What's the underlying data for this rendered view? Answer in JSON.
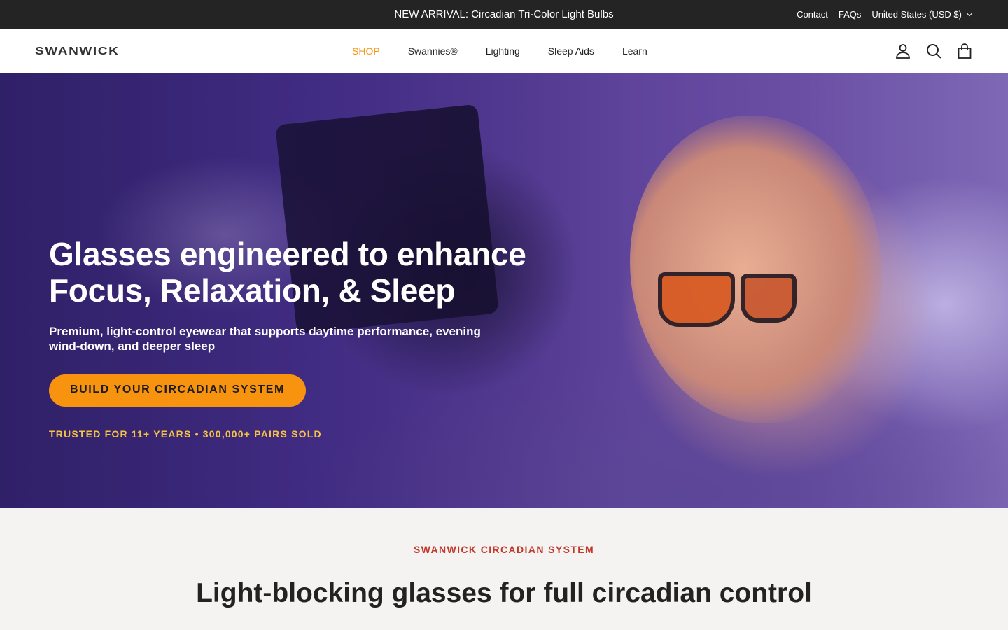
{
  "announcement": {
    "promo_text": "NEW ARRIVAL: Circadian Tri-Color Light Bulbs",
    "links": [
      "Contact",
      "FAQs"
    ],
    "currency": "United States (USD $)"
  },
  "header": {
    "logo": "SWANWICK",
    "nav": [
      "SHOP",
      "Swannies®",
      "Lighting",
      "Sleep Aids",
      "Learn"
    ],
    "active_nav": "SHOP",
    "icons": [
      "account-icon",
      "search-icon",
      "cart-icon"
    ]
  },
  "hero": {
    "title_line1": "Glasses engineered to enhance",
    "title_line2": "Focus, Relaxation, & Sleep",
    "subtitle": "Premium, light-control eyewear that supports daytime performance, evening wind-down, and deeper sleep",
    "cta_label": "BUILD YOUR CIRCADIAN SYSTEM",
    "trust_text": "TRUSTED FOR 11+ YEARS • 300,000+ PAIRS SOLD"
  },
  "section": {
    "eyebrow": "SWANWICK CIRCADIAN SYSTEM",
    "title": "Light-blocking glasses for full circadian control"
  },
  "colors": {
    "accent": "#f7930f",
    "announcement_bg": "#242424",
    "eyebrow": "#c0392b",
    "trust": "#f5c242"
  }
}
